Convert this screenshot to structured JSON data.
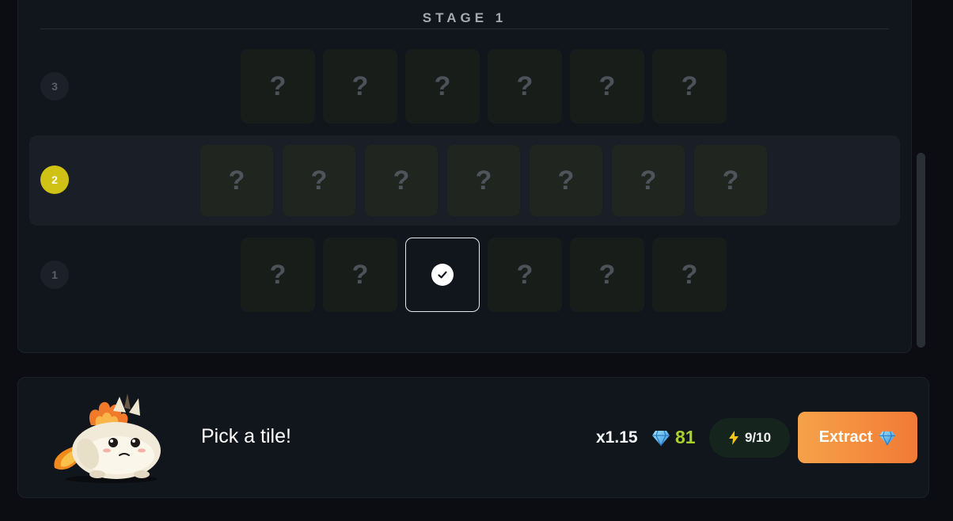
{
  "stage": {
    "title": "STAGE 1"
  },
  "rows": [
    {
      "number": "3",
      "tiles": [
        "?",
        "?",
        "?",
        "?",
        "?",
        "?"
      ]
    },
    {
      "number": "2",
      "tiles": [
        "?",
        "?",
        "?",
        "?",
        "?",
        "?",
        "?"
      ]
    },
    {
      "number": "1",
      "tiles": [
        "?",
        "?",
        "",
        "?",
        "?",
        "?"
      ]
    }
  ],
  "status": {
    "message": "Pick a tile!"
  },
  "stats": {
    "multiplier": "x1.15",
    "gems": "81",
    "energy": "9/10"
  },
  "actions": {
    "extract_label": "Extract"
  },
  "icons": {
    "gem": "diamond-icon",
    "energy": "lightning-icon",
    "selected": "check-icon"
  },
  "colors": {
    "accent_orange": "#f27a35",
    "active_row_badge": "#d0c214",
    "gem_count": "#a9d12c",
    "energy_pill": "#15241d"
  }
}
